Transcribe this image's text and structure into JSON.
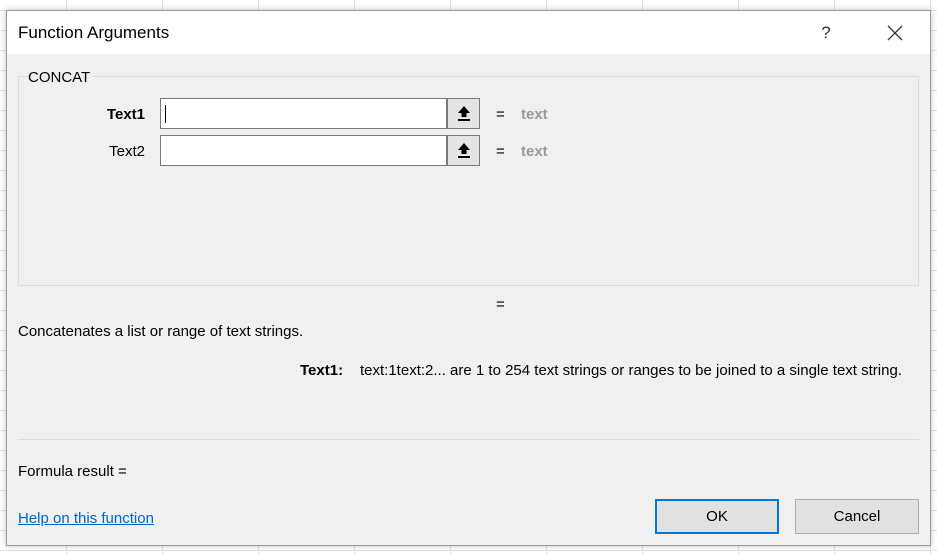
{
  "window": {
    "title": "Function Arguments",
    "help_glyph": "?"
  },
  "function": {
    "name": "CONCAT",
    "args": [
      {
        "label": "Text1",
        "value": "",
        "result_prefix": "=",
        "result": "text"
      },
      {
        "label": "Text2",
        "value": "",
        "result_prefix": "=",
        "result": "text"
      }
    ],
    "overall_result_prefix": "=",
    "description": "Concatenates a list or range of text strings.",
    "arg_help_name": "Text1:",
    "arg_help_text": "text:1text:2... are 1 to 254 text strings or ranges to be joined to a single text string."
  },
  "footer": {
    "formula_result": "Formula result =",
    "help_link": "Help on this function",
    "ok_label": "OK",
    "cancel_label": "Cancel"
  },
  "icons": {
    "help": "help-icon",
    "close": "close-icon",
    "collapse": "collapse-dialog-icon"
  },
  "colors": {
    "link": "#0066cc",
    "focus_border": "#0078d7",
    "placeholder_result": "#9a9a9a"
  }
}
